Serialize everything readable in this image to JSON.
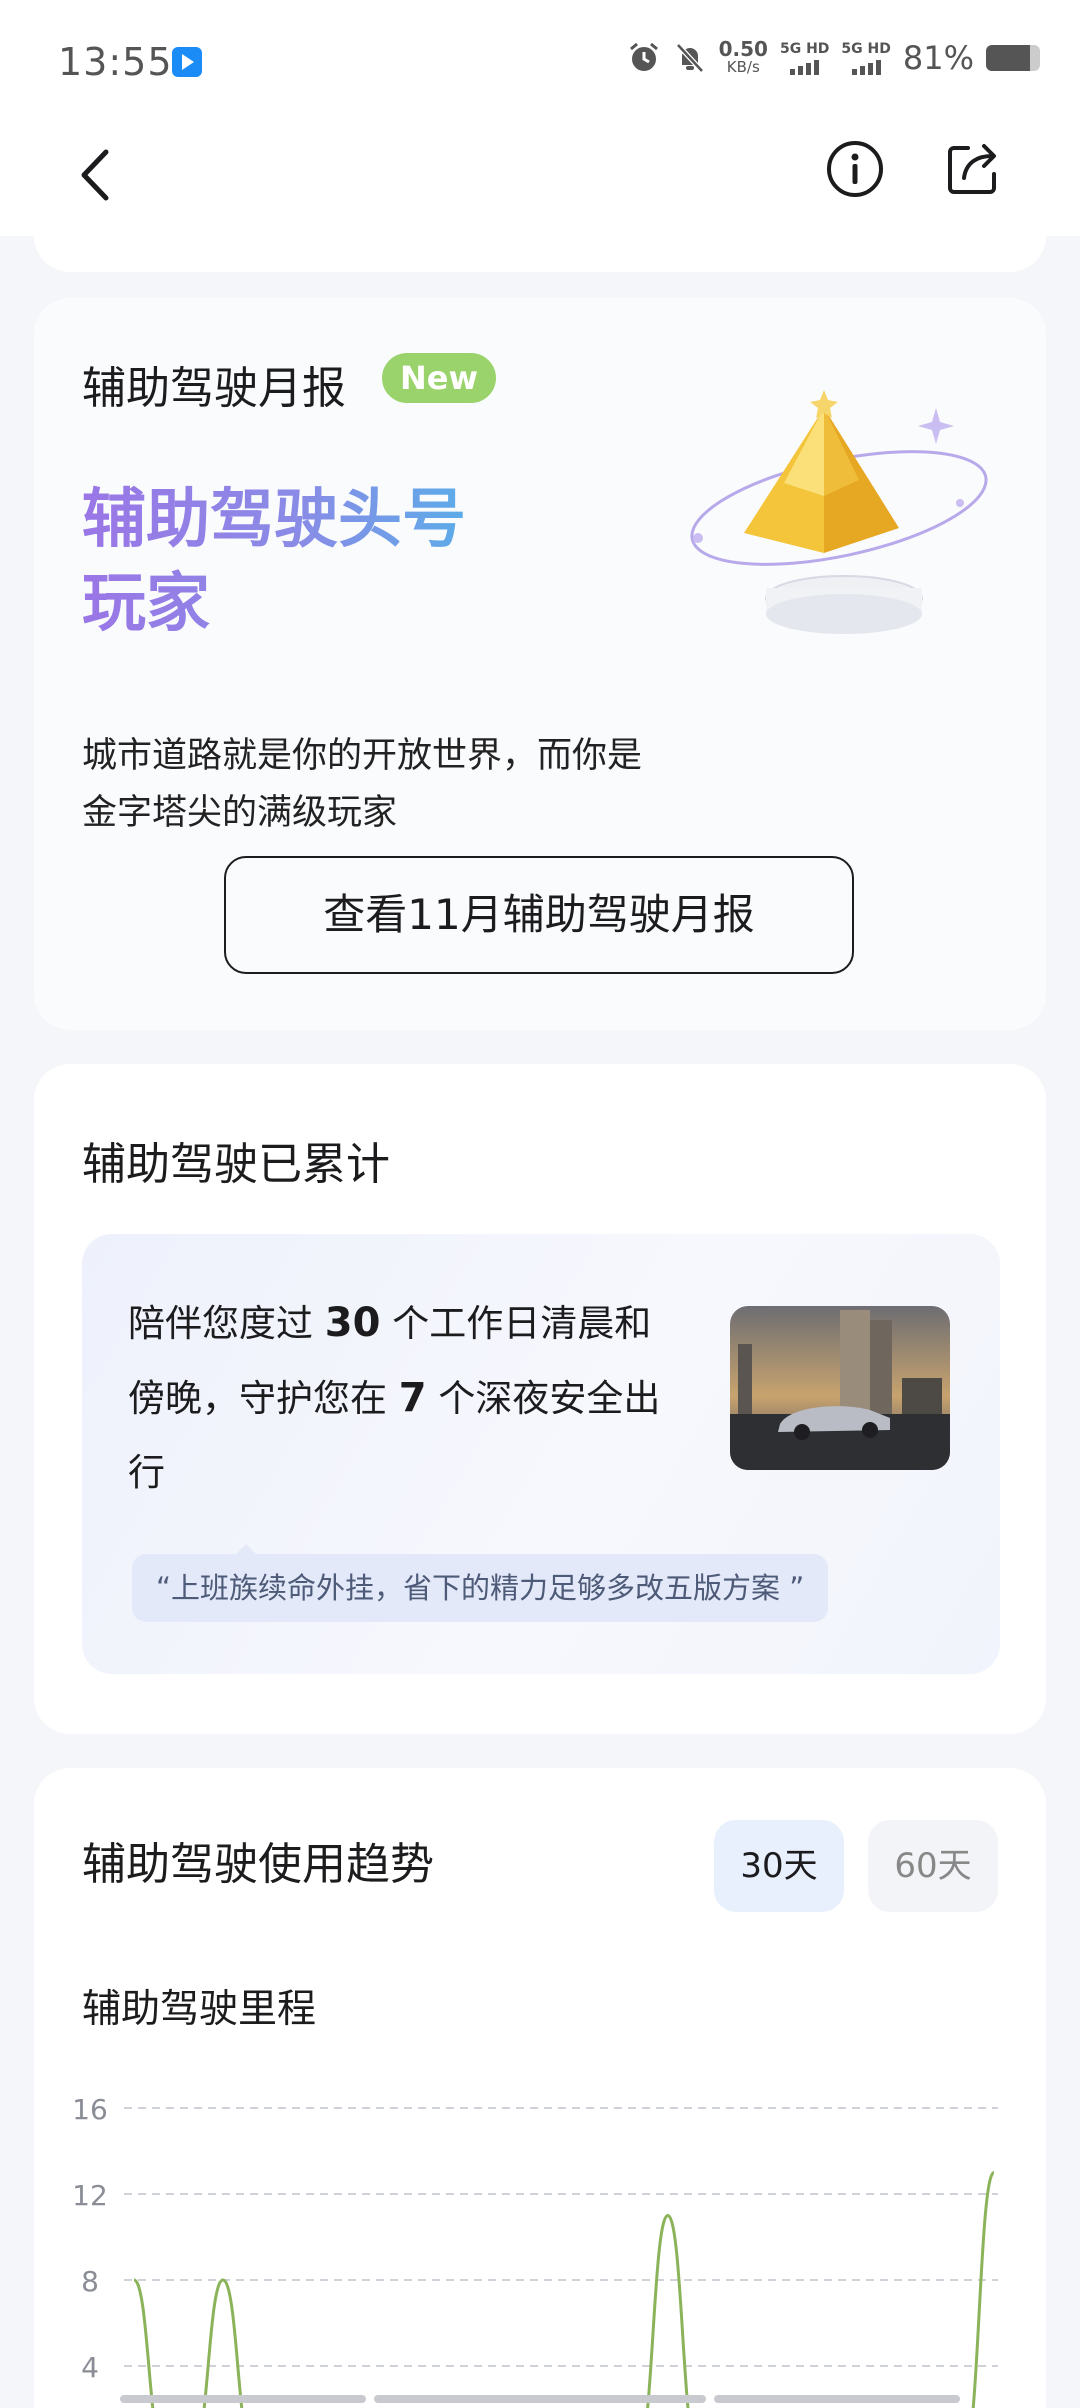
{
  "status_bar": {
    "time": "13:55",
    "net_speed_value": "0.50",
    "net_speed_unit": "KB/s",
    "sim1_label": "5G HD",
    "sim2_label": "5G HD",
    "battery_percent_text": "81%",
    "battery_level": 0.81
  },
  "nav": {
    "back_icon": "chevron-left-icon",
    "info_icon": "info-icon",
    "share_icon": "share-icon"
  },
  "report": {
    "title": "辅助驾驶月报",
    "badge": "New",
    "headline": "辅助驾驶头号玩家",
    "description": "城市道路就是你的开放世界，而你是金字塔尖的满级玩家",
    "button_label": "查看11月辅助驾驶月报"
  },
  "accumulated": {
    "title": "辅助驾驶已累计",
    "text_prefix": "陪伴您度过 ",
    "workdays": "30",
    "text_middle": " 个工作日清晨和傍晚，守护您在 ",
    "nights": "7",
    "text_suffix": " 个深夜安全出行",
    "quote": "“上班族续命外挂，省下的精力足够多改五版方案 ”"
  },
  "trend": {
    "title": "辅助驾驶使用趋势",
    "tabs": [
      {
        "label": "30天",
        "active": true
      },
      {
        "label": "60天",
        "active": false
      }
    ],
    "chart_title": "辅助驾驶里程"
  },
  "colors": {
    "accent_green": "#8bb35a",
    "badge_green": "#9ad36b",
    "title_gradient_start": "#9a76e6",
    "title_gradient_end": "#4fb5ea"
  },
  "chart_data": {
    "type": "line",
    "title": "辅助驾驶里程",
    "xlabel": "",
    "ylabel": "",
    "y_ticks": [
      "16",
      "12",
      "8",
      "4"
    ],
    "ylim": [
      0,
      16
    ],
    "grid": true,
    "x": [
      0,
      1,
      2,
      3,
      4,
      5,
      6,
      7,
      8,
      9,
      10,
      11,
      12,
      13,
      14,
      15,
      16,
      17,
      18,
      19,
      20,
      21,
      22,
      23,
      24,
      25,
      26,
      27,
      28,
      29
    ],
    "series": [
      {
        "values": [
          8,
          0,
          0,
          8,
          0,
          0,
          0,
          0,
          0,
          0,
          0,
          0,
          0,
          0,
          0,
          0,
          0,
          0,
          11,
          0,
          0,
          0,
          0,
          0,
          0,
          0,
          0,
          0,
          0,
          13
        ]
      }
    ]
  }
}
